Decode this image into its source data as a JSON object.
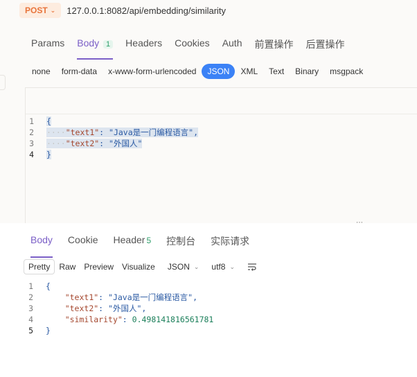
{
  "request": {
    "method": "POST",
    "url": "127.0.0.1:8082/api/embedding/similarity"
  },
  "request_tabs": [
    {
      "label": "Params"
    },
    {
      "label": "Body",
      "count": "1"
    },
    {
      "label": "Headers"
    },
    {
      "label": "Cookies"
    },
    {
      "label": "Auth"
    },
    {
      "label": "前置操作"
    },
    {
      "label": "后置操作"
    }
  ],
  "body_types": [
    "none",
    "form-data",
    "x-www-form-urlencoded",
    "JSON",
    "XML",
    "Text",
    "Binary",
    "msgpack"
  ],
  "request_body": {
    "line_numbers": [
      "1",
      "2",
      "3",
      "4"
    ],
    "open_brace": "{",
    "close_brace": "}",
    "key1": "\"text1\"",
    "val1": "\"Java是一门编程语言\"",
    "key2": "\"text2\"",
    "val2": "\"外国人\""
  },
  "splitter": "⋯",
  "response_tabs": [
    {
      "label": "Body"
    },
    {
      "label": "Cookie"
    },
    {
      "label": "Header",
      "count": "5"
    },
    {
      "label": "控制台"
    },
    {
      "label": "实际请求"
    }
  ],
  "view_modes": [
    "Pretty",
    "Raw",
    "Preview",
    "Visualize"
  ],
  "format_select": "JSON",
  "encoding_select": "utf8",
  "response_body": {
    "line_numbers": [
      "1",
      "2",
      "3",
      "4",
      "5"
    ],
    "open_brace": "{",
    "close_brace": "}",
    "key1": "\"text1\"",
    "val1": "\"Java是一门编程语言\"",
    "key2": "\"text2\"",
    "val2": "\"外国人\"",
    "key3": "\"similarity\"",
    "val3": "0.498141816561781"
  },
  "colors": {
    "accent": "#7b5fc7",
    "method": "#e8743b",
    "json_active": "#3b82f6"
  }
}
